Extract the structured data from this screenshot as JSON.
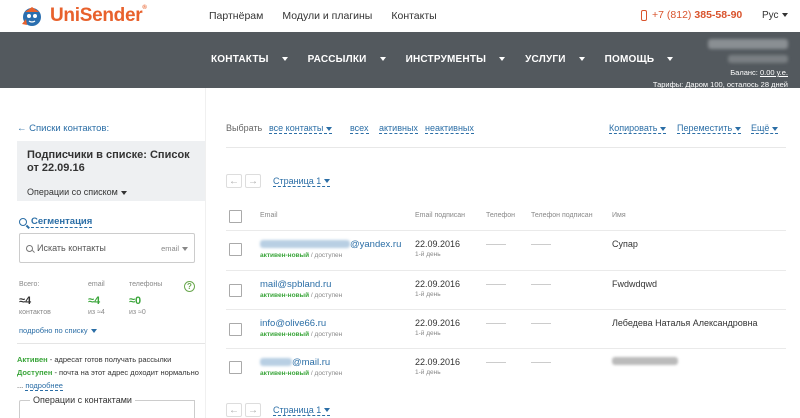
{
  "header": {
    "brand": "UniSender",
    "brand_mark": "®",
    "nav": [
      "Партнёрам",
      "Модули и плагины",
      "Контакты"
    ],
    "phone_prefix": "+7 (812)",
    "phone_number": "385-58-90",
    "language": "Рус",
    "accent_color": "#e8612c"
  },
  "mainnav": {
    "items": [
      "КОНТАКТЫ",
      "РАССЫЛКИ",
      "ИНСТРУМЕНТЫ",
      "УСЛУГИ",
      "ПОМОЩЬ"
    ],
    "background": "#53595e"
  },
  "account": {
    "balance_label": "Баланс:",
    "balance_value": "0.00 у.е.",
    "tariff_label": "Тарифы:",
    "tariff_value": "Даром 100",
    "remaining": ", осталось 28 дней"
  },
  "sidebar": {
    "back_link": "← Списки контактов:",
    "list_title": "Подписчики в списке: Список от 22.09.16",
    "list_ops": "Операции со списком",
    "segmentation": "Сегментация",
    "search_placeholder": "Искать контакты",
    "search_field": "email",
    "stats": {
      "headers": [
        "Всего:",
        "email",
        "телефоны"
      ],
      "values": [
        "≈4",
        "≈4",
        "≈0"
      ],
      "subs": [
        "контактов",
        "из ≈4",
        "из ≈0"
      ],
      "help": "?"
    },
    "detail_link": "подробно по списку",
    "legend_active_label": "Активен",
    "legend_active_text": " - адресат готов получать рассылки",
    "legend_avail_label": "Доступен",
    "legend_avail_text": " - почта на этот адрес доходит нормально ... ",
    "legend_more": "подробнее",
    "ops_title": "Операции с контактами"
  },
  "toolbar": {
    "select_label": "Выбрать",
    "all_contacts": "все контакты",
    "filter_all": "всех",
    "filter_active": "активных",
    "filter_inactive": "неактивных",
    "copy": "Копировать",
    "move": "Переместить",
    "more": "Ещё"
  },
  "pager": {
    "prev": "←",
    "next": "→",
    "page_label": "Страница 1"
  },
  "table": {
    "columns": [
      "Email",
      "Email подписан",
      "Телефон",
      "Телефон подписан",
      "Имя"
    ],
    "rows": [
      {
        "email_prefix_hidden": true,
        "email": "@yandex.ru",
        "status_main": "активен-новый",
        "status_sub": " / доступен",
        "date": "22.09.2016",
        "ago": "1-й день",
        "name": "Супар",
        "name_hidden": false
      },
      {
        "email_prefix_hidden": false,
        "email": "mail@spbland.ru",
        "status_main": "активен-новый",
        "status_sub": " / доступен",
        "date": "22.09.2016",
        "ago": "1-й день",
        "name": "Fwdwdqwd",
        "name_hidden": false
      },
      {
        "email_prefix_hidden": false,
        "email": "info@olive66.ru",
        "status_main": "активен-новый",
        "status_sub": " / доступен",
        "date": "22.09.2016",
        "ago": "1-й день",
        "name": "Лебедева Наталья Александровна",
        "name_hidden": false
      },
      {
        "email_prefix_hidden": true,
        "email": "@mail.ru",
        "status_main": "активен-новый",
        "status_sub": " / доступен",
        "date": "22.09.2016",
        "ago": "1-й день",
        "name": "",
        "name_hidden": true
      }
    ]
  }
}
